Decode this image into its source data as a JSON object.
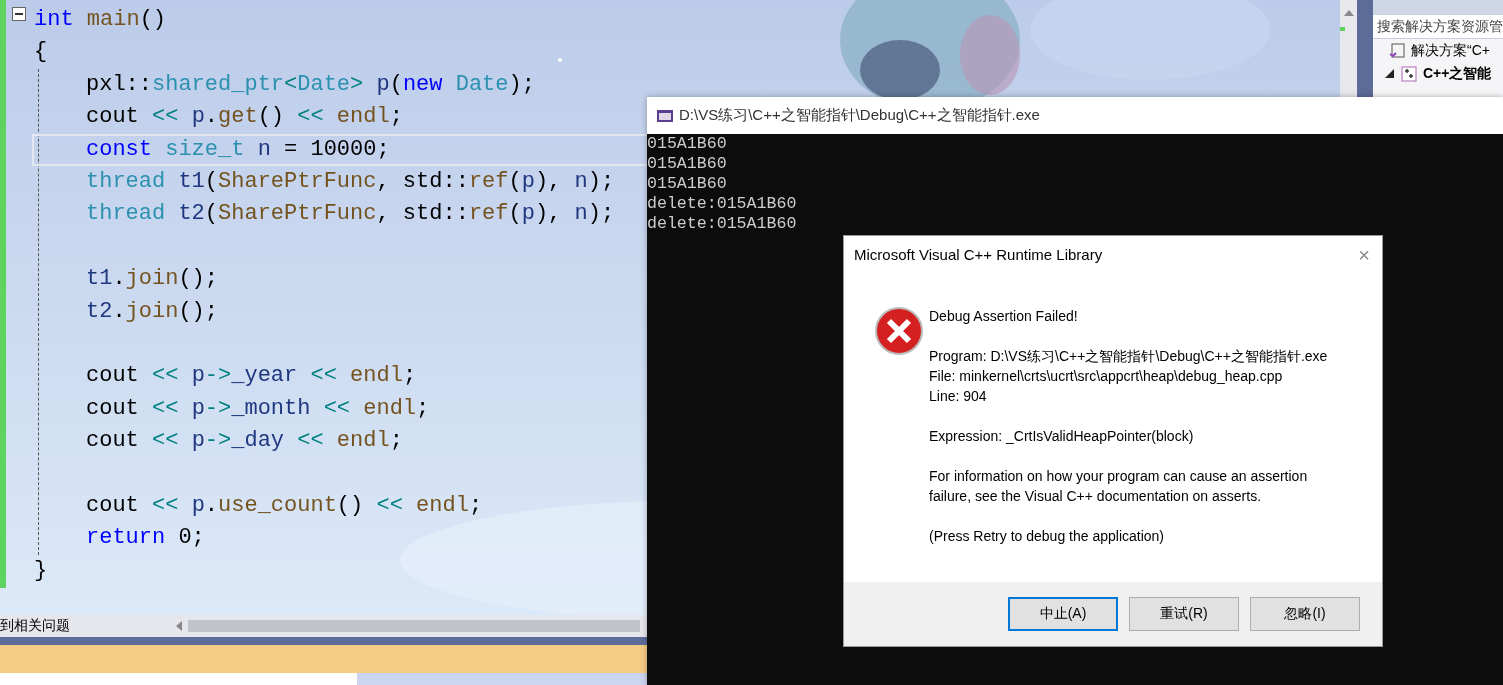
{
  "editor": {
    "lines": [
      {
        "kind": "code",
        "tokens": [
          {
            "text": "int ",
            "kind": "keyword"
          },
          {
            "text": "main",
            "kind": "function"
          },
          {
            "text": "()",
            "kind": "plain"
          }
        ],
        "collapsible": true,
        "current": false
      },
      {
        "kind": "code",
        "tokens": [
          {
            "text": "{",
            "kind": "plain"
          }
        ],
        "current": false,
        "children": [
          {
            "kind": "code",
            "tokens": [
              {
                "text": "pxl::",
                "kind": "plain"
              },
              {
                "text": "shared_ptr",
                "kind": "type"
              },
              {
                "text": "<",
                "kind": "operator"
              },
              {
                "text": "Date",
                "kind": "type"
              },
              {
                "text": "> ",
                "kind": "operator"
              },
              {
                "text": "p",
                "kind": "variable"
              },
              {
                "text": "(",
                "kind": "plain"
              },
              {
                "text": "new ",
                "kind": "keyword"
              },
              {
                "text": "Date",
                "kind": "type"
              },
              {
                "text": ");",
                "kind": "plain"
              }
            ],
            "current": false
          },
          {
            "kind": "code",
            "tokens": [
              {
                "text": "cout ",
                "kind": "plain"
              },
              {
                "text": "<< ",
                "kind": "operator"
              },
              {
                "text": "p",
                "kind": "variable"
              },
              {
                "text": ".",
                "kind": "plain"
              },
              {
                "text": "get",
                "kind": "function"
              },
              {
                "text": "() ",
                "kind": "plain"
              },
              {
                "text": "<< ",
                "kind": "operator"
              },
              {
                "text": "endl",
                "kind": "function"
              },
              {
                "text": ";",
                "kind": "plain"
              }
            ],
            "current": false
          },
          {
            "kind": "code",
            "tokens": [
              {
                "text": "const ",
                "kind": "keyword"
              },
              {
                "text": "size_t ",
                "kind": "type"
              },
              {
                "text": "n",
                "kind": "variable"
              },
              {
                "text": " = 10000;",
                "kind": "plain"
              }
            ],
            "current": true
          },
          {
            "kind": "code",
            "tokens": [
              {
                "text": "thread ",
                "kind": "type"
              },
              {
                "text": "t1",
                "kind": "variable"
              },
              {
                "text": "(",
                "kind": "plain"
              },
              {
                "text": "SharePtrFunc",
                "kind": "function"
              },
              {
                "text": ", std::",
                "kind": "plain"
              },
              {
                "text": "ref",
                "kind": "function"
              },
              {
                "text": "(",
                "kind": "plain"
              },
              {
                "text": "p",
                "kind": "variable"
              },
              {
                "text": "), ",
                "kind": "plain"
              },
              {
                "text": "n",
                "kind": "variable"
              },
              {
                "text": ");",
                "kind": "plain"
              }
            ],
            "current": false
          },
          {
            "kind": "code",
            "tokens": [
              {
                "text": "thread ",
                "kind": "type"
              },
              {
                "text": "t2",
                "kind": "variable"
              },
              {
                "text": "(",
                "kind": "plain"
              },
              {
                "text": "SharePtrFunc",
                "kind": "function"
              },
              {
                "text": ", std::",
                "kind": "plain"
              },
              {
                "text": "ref",
                "kind": "function"
              },
              {
                "text": "(",
                "kind": "plain"
              },
              {
                "text": "p",
                "kind": "variable"
              },
              {
                "text": "), ",
                "kind": "plain"
              },
              {
                "text": "n",
                "kind": "variable"
              },
              {
                "text": ");",
                "kind": "plain"
              }
            ],
            "current": false
          },
          {
            "kind": "blank"
          },
          {
            "kind": "code",
            "tokens": [
              {
                "text": "t1",
                "kind": "variable"
              },
              {
                "text": ".",
                "kind": "plain"
              },
              {
                "text": "join",
                "kind": "function"
              },
              {
                "text": "();",
                "kind": "plain"
              }
            ],
            "current": false
          },
          {
            "kind": "code",
            "tokens": [
              {
                "text": "t2",
                "kind": "variable"
              },
              {
                "text": ".",
                "kind": "plain"
              },
              {
                "text": "join",
                "kind": "function"
              },
              {
                "text": "();",
                "kind": "plain"
              }
            ],
            "current": false
          },
          {
            "kind": "blank"
          },
          {
            "kind": "code",
            "tokens": [
              {
                "text": "cout ",
                "kind": "plain"
              },
              {
                "text": "<< ",
                "kind": "operator"
              },
              {
                "text": "p",
                "kind": "variable"
              },
              {
                "text": "->",
                "kind": "operator"
              },
              {
                "text": "_year ",
                "kind": "variable"
              },
              {
                "text": "<< ",
                "kind": "operator"
              },
              {
                "text": "endl",
                "kind": "function"
              },
              {
                "text": ";",
                "kind": "plain"
              }
            ],
            "current": false
          },
          {
            "kind": "code",
            "tokens": [
              {
                "text": "cout ",
                "kind": "plain"
              },
              {
                "text": "<< ",
                "kind": "operator"
              },
              {
                "text": "p",
                "kind": "variable"
              },
              {
                "text": "->",
                "kind": "operator"
              },
              {
                "text": "_month ",
                "kind": "variable"
              },
              {
                "text": "<< ",
                "kind": "operator"
              },
              {
                "text": "endl",
                "kind": "function"
              },
              {
                "text": ";",
                "kind": "plain"
              }
            ],
            "current": false
          },
          {
            "kind": "code",
            "tokens": [
              {
                "text": "cout ",
                "kind": "plain"
              },
              {
                "text": "<< ",
                "kind": "operator"
              },
              {
                "text": "p",
                "kind": "variable"
              },
              {
                "text": "->",
                "kind": "operator"
              },
              {
                "text": "_day ",
                "kind": "variable"
              },
              {
                "text": "<< ",
                "kind": "operator"
              },
              {
                "text": "endl",
                "kind": "function"
              },
              {
                "text": ";",
                "kind": "plain"
              }
            ],
            "current": false
          },
          {
            "kind": "blank"
          },
          {
            "kind": "code",
            "tokens": [
              {
                "text": "cout ",
                "kind": "plain"
              },
              {
                "text": "<< ",
                "kind": "operator"
              },
              {
                "text": "p",
                "kind": "variable"
              },
              {
                "text": ".",
                "kind": "plain"
              },
              {
                "text": "use_count",
                "kind": "function"
              },
              {
                "text": "() ",
                "kind": "plain"
              },
              {
                "text": "<< ",
                "kind": "operator"
              },
              {
                "text": "endl",
                "kind": "function"
              },
              {
                "text": ";",
                "kind": "plain"
              }
            ],
            "current": false
          },
          {
            "kind": "code",
            "tokens": [
              {
                "text": "return",
                "kind": "keyword"
              },
              {
                "text": " 0;",
                "kind": "plain"
              }
            ],
            "current": false
          }
        ]
      },
      {
        "kind": "code",
        "tokens": [
          {
            "text": "}",
            "kind": "plain"
          }
        ],
        "current": false
      }
    ]
  },
  "error_list": {
    "label": "到相关问题"
  },
  "solution_explorer": {
    "search": {
      "placeholder": "搜索解决方案资源管"
    },
    "items": [
      {
        "label": "解决方案“C+",
        "bold": false,
        "expanded": false
      },
      {
        "label": "C++之智能",
        "bold": true,
        "expanded": true
      }
    ]
  },
  "console": {
    "title": "D:\\VS练习\\C++之智能指针\\Debug\\C++之智能指针.exe",
    "output": [
      "015A1B60",
      "015A1B60",
      "015A1B60",
      "delete:015A1B60",
      "delete:015A1B60"
    ]
  },
  "dialog": {
    "title": "Microsoft Visual C++ Runtime Library",
    "close": "×",
    "message_groups": [
      [
        "Debug Assertion Failed!"
      ],
      [
        "Program: D:\\VS练习\\C++之智能指针\\Debug\\C++之智能指针.exe",
        "File: minkernel\\crts\\ucrt\\src\\appcrt\\heap\\debug_heap.cpp",
        "Line: 904"
      ],
      [
        "Expression: _CrtIsValidHeapPointer(block)"
      ],
      [
        "For information on how your program can cause an assertion failure, see the Visual C++ documentation on asserts."
      ],
      [
        "(Press Retry to debug the application)"
      ]
    ],
    "buttons": [
      {
        "label": "中止(A)",
        "default": true
      },
      {
        "label": "重试(R)",
        "default": false
      },
      {
        "label": "忽略(I)",
        "default": false
      }
    ]
  }
}
